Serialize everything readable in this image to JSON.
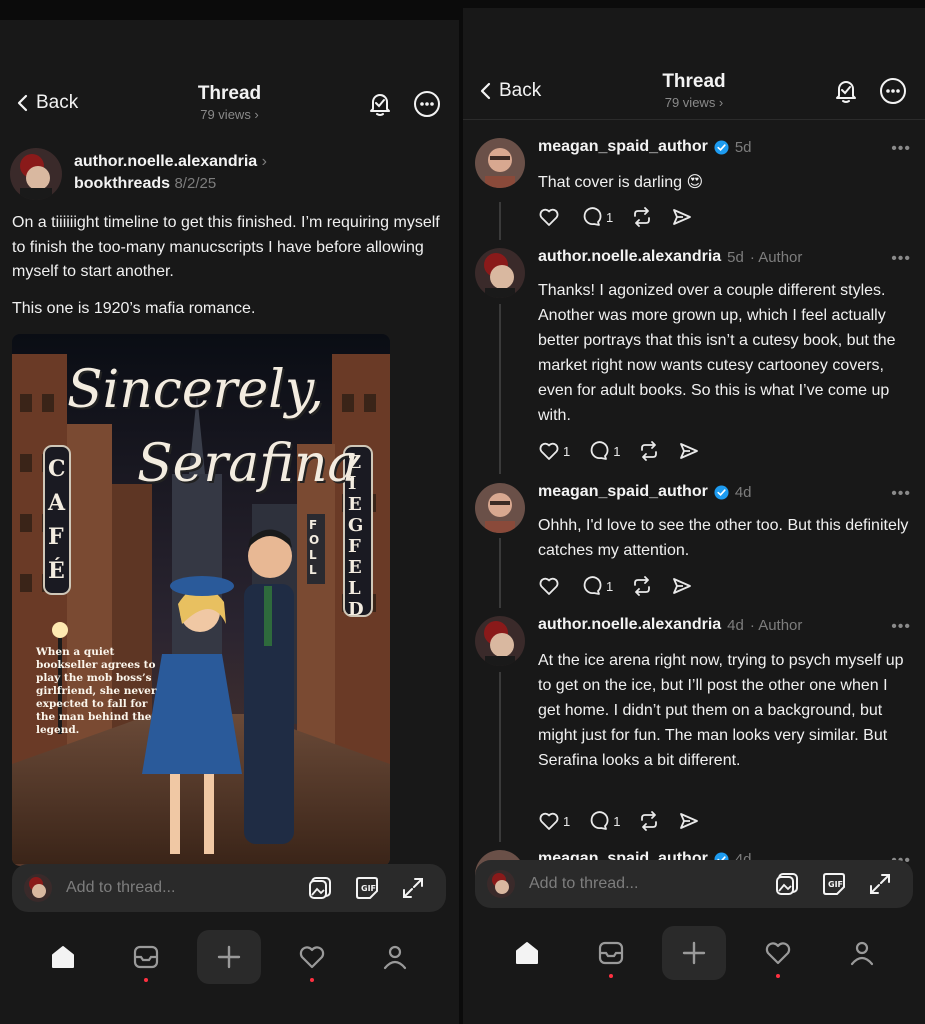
{
  "left": {
    "header": {
      "back_label": "Back",
      "title": "Thread",
      "views": "79 views ›"
    },
    "post": {
      "author": "author.noelle.alexandria",
      "community": "bookthreads",
      "date": "8/2/25",
      "text1": "On a tiiiiiight timeline to get this finished. I’m requiring myself to finish the too-many manucscripts I have before allowing myself to start another.",
      "text2": "This one is 1920’s mafia romance.",
      "cover": {
        "title_line1": "Sincerely,",
        "title_line2": "Serafina",
        "sign_left": "CAFÉ",
        "sign_right": "ZIEGFELD",
        "sign_mid": "FOLL",
        "blurb": "When a quiet bookseller agrees to play the mob boss’s girlfriend, she never expected to fall for the man behind the legend."
      }
    },
    "composer": {
      "placeholder": "Add to thread..."
    }
  },
  "right": {
    "header": {
      "back_label": "Back",
      "title": "Thread",
      "views": "79 views ›"
    },
    "replies": [
      {
        "author": "meagan_spaid_author",
        "verified": true,
        "time": "5d",
        "tag": "",
        "text": "That cover is darling 😍",
        "likes": "",
        "comments": "1"
      },
      {
        "author": "author.noelle.alexandria",
        "verified": false,
        "time": "5d",
        "tag": "· Author",
        "text": "Thanks!  I agonized over a couple different styles.  Another was more grown up, which I feel actually better portrays that this isn’t a cutesy book, but the market right now wants cutesy cartooney covers, even for adult books.  So this is what I’ve come up with.",
        "likes": "1",
        "comments": "1"
      },
      {
        "author": "meagan_spaid_author",
        "verified": true,
        "time": "4d",
        "tag": "",
        "text": "Ohhh, I'd love to see the other too. But this definitely catches my attention.",
        "likes": "",
        "comments": "1"
      },
      {
        "author": "author.noelle.alexandria",
        "verified": false,
        "time": "4d",
        "tag": "· Author",
        "text": "At the ice arena right now, trying to psych myself up to get on the ice, but I’ll post the other one when I get home. I didn’t put them on a background, but might just for fun. The man looks very similar. But Serafina looks a bit different.",
        "likes": "1",
        "comments": "1"
      },
      {
        "author": "meagan_spaid_author",
        "verified": true,
        "time": "4d",
        "tag": "",
        "text": "",
        "likes": "",
        "comments": ""
      }
    ],
    "composer": {
      "placeholder": "Add to thread..."
    }
  },
  "tabbar_icons": [
    "home-icon",
    "inbox-icon",
    "create-icon",
    "activity-icon",
    "profile-icon"
  ],
  "colors": {
    "background": "#181818",
    "text": "#f3f3f3",
    "muted": "#7d7d7d",
    "verified": "#1d9bf0",
    "notification_dot": "#ff3040",
    "composer": "#2a2a2a"
  }
}
